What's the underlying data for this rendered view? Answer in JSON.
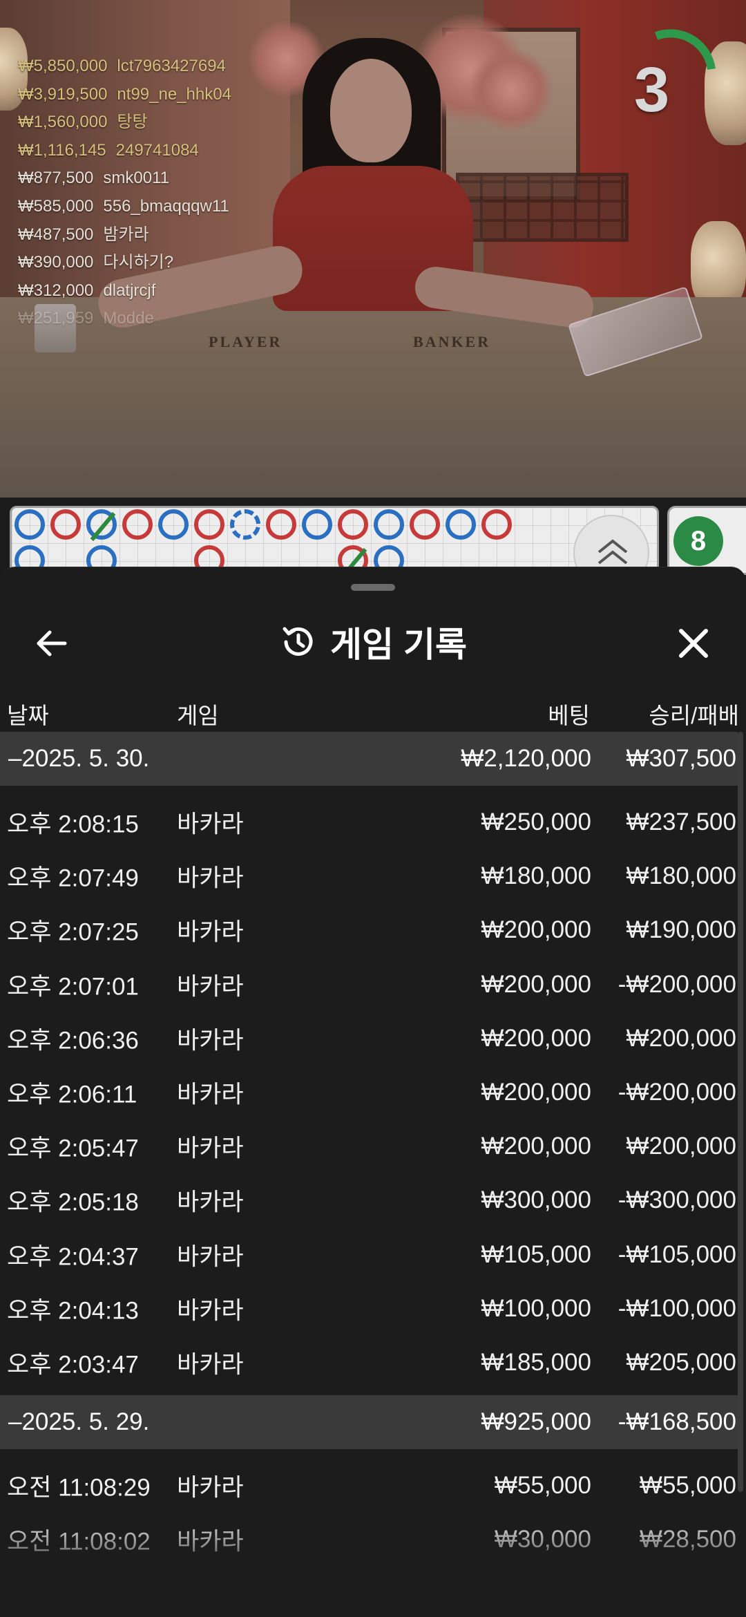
{
  "winners": [
    {
      "amount": "₩5,850,000",
      "name": "lct7963427694"
    },
    {
      "amount": "₩3,919,500",
      "name": "nt99_ne_hhk04"
    },
    {
      "amount": "₩1,560,000",
      "name": "탕탕"
    },
    {
      "amount": "₩1,116,145",
      "name": "249741084"
    },
    {
      "amount": "₩877,500",
      "name": "smk0011"
    },
    {
      "amount": "₩585,000",
      "name": "556_bmaqqqw11"
    },
    {
      "amount": "₩487,500",
      "name": "밤카라"
    },
    {
      "amount": "₩390,000",
      "name": "다시하기?"
    },
    {
      "amount": "₩312,000",
      "name": "dlatjrcjf"
    },
    {
      "amount": "₩251,959",
      "name": "Modde"
    }
  ],
  "countdown": "3",
  "table_labels": {
    "player": "PLAYER",
    "banker": "BANKER"
  },
  "roadmap_side": {
    "ball": "8"
  },
  "sheet": {
    "title": "게임 기록",
    "columns": {
      "date": "날짜",
      "game": "게임",
      "bet": "베팅",
      "result": "승리/패배"
    },
    "groups": [
      {
        "date": "–2025. 5. 30.",
        "bet": "₩2,120,000",
        "result": "₩307,500",
        "rows": [
          {
            "time": "오후 2:08:15",
            "game": "바카라",
            "bet": "₩250,000",
            "result": "₩237,500"
          },
          {
            "time": "오후 2:07:49",
            "game": "바카라",
            "bet": "₩180,000",
            "result": "₩180,000"
          },
          {
            "time": "오후 2:07:25",
            "game": "바카라",
            "bet": "₩200,000",
            "result": "₩190,000"
          },
          {
            "time": "오후 2:07:01",
            "game": "바카라",
            "bet": "₩200,000",
            "result": "-₩200,000"
          },
          {
            "time": "오후 2:06:36",
            "game": "바카라",
            "bet": "₩200,000",
            "result": "₩200,000"
          },
          {
            "time": "오후 2:06:11",
            "game": "바카라",
            "bet": "₩200,000",
            "result": "-₩200,000"
          },
          {
            "time": "오후 2:05:47",
            "game": "바카라",
            "bet": "₩200,000",
            "result": "₩200,000"
          },
          {
            "time": "오후 2:05:18",
            "game": "바카라",
            "bet": "₩300,000",
            "result": "-₩300,000"
          },
          {
            "time": "오후 2:04:37",
            "game": "바카라",
            "bet": "₩105,000",
            "result": "-₩105,000"
          },
          {
            "time": "오후 2:04:13",
            "game": "바카라",
            "bet": "₩100,000",
            "result": "-₩100,000"
          },
          {
            "time": "오후 2:03:47",
            "game": "바카라",
            "bet": "₩185,000",
            "result": "₩205,000"
          }
        ]
      },
      {
        "date": "–2025. 5. 29.",
        "bet": "₩925,000",
        "result": "-₩168,500",
        "rows": [
          {
            "time": "오전 11:08:29",
            "game": "바카라",
            "bet": "₩55,000",
            "result": "₩55,000"
          },
          {
            "time": "오전 11:08:02",
            "game": "바카라",
            "bet": "₩30,000",
            "result": "₩28,500"
          }
        ]
      }
    ]
  },
  "colors": {
    "accent_green": "#2c9a4a",
    "sheet_bg": "#1c1c1c",
    "group_bg": "#3a3a3a"
  }
}
